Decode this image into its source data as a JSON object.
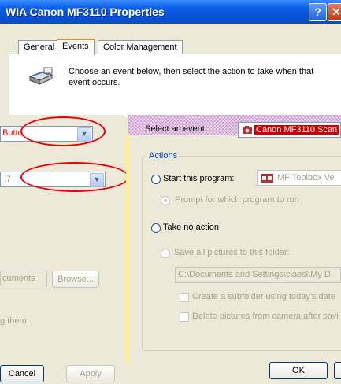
{
  "window": {
    "title": "WIA Canon MF3110 Properties",
    "help_glyph": "?",
    "close_glyph": "✕"
  },
  "tabs": [
    {
      "label": "General"
    },
    {
      "label": "Events"
    },
    {
      "label": "Color Management"
    }
  ],
  "events_header": {
    "icon": "scanner-icon",
    "description": "Choose an event below, then select the action to take when that event occurs."
  },
  "left_fragment": {
    "event_combo_text": "Butto",
    "second_combo_text": ".7",
    "browse_path_fragment": "cuments",
    "browse_label": "Browse...",
    "trailing_text": "g them",
    "cancel_label": "Cancel",
    "apply_label": "Apply"
  },
  "right_panel": {
    "select_event_label": "Select an event:",
    "event_value": "Canon MF3110 Scan",
    "actions_group_label": "Actions",
    "start_program_label": "Start this program:",
    "program_value": "MF Toolbox Ve",
    "prompt_label": "Prompt for which program to run",
    "take_no_action_label": "Take no action",
    "save_pictures_label": "Save all pictures to this folder:",
    "folder_path": "C:\\Documents and Settings\\claesl\\My D",
    "create_subfolder_label": "Create a subfolder using today's date",
    "delete_pictures_label": "Delete pictures from camera after savi",
    "ok_label": "OK"
  }
}
